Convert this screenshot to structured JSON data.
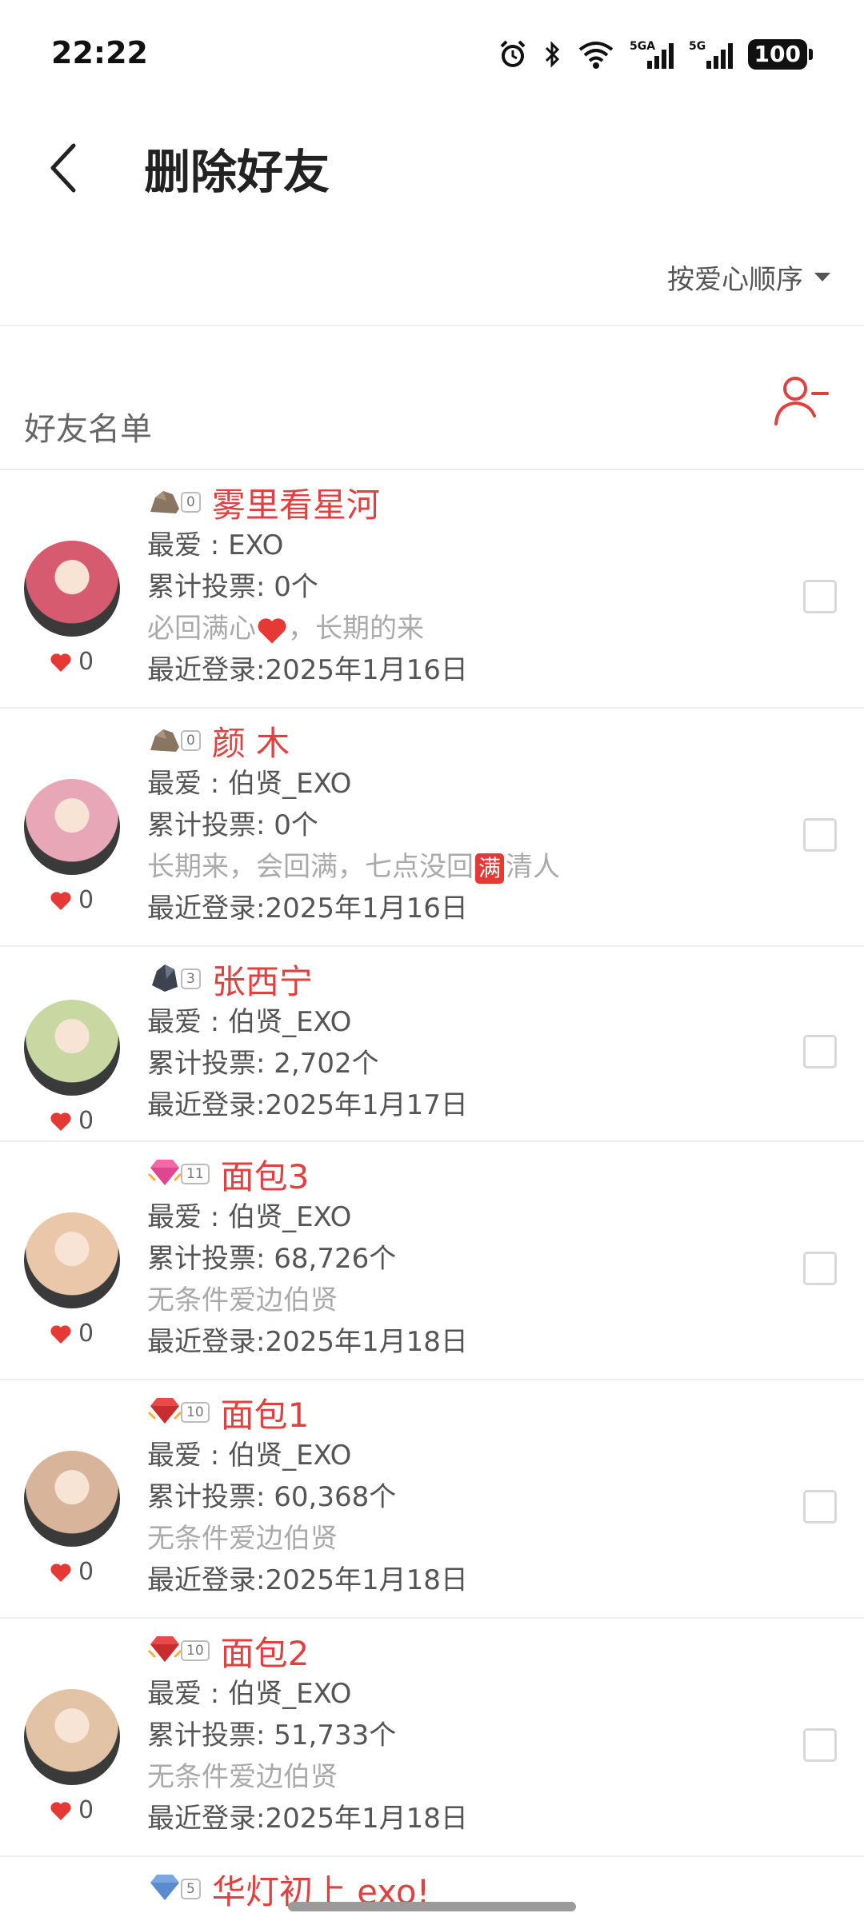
{
  "status": {
    "time": "22:22",
    "battery": "100",
    "net1": "5GA",
    "net2": "5G"
  },
  "header": {
    "title": "删除好友"
  },
  "sort": {
    "label": "按爱心顺序"
  },
  "friends": {
    "title": "好友名单"
  },
  "colors": {
    "accent": "#e04040",
    "muted": "#aaaaaa"
  },
  "rows": [
    {
      "gem": "rock",
      "level": "0",
      "name": "雾里看星河",
      "fav": "最爱 : EXO",
      "votes": "累计投票: 0个",
      "note_pre": "必回满心",
      "note_post": "，长期的来",
      "login": "最近登录:2025年1月16日",
      "hearts": "0",
      "avatar": "#d65b6f"
    },
    {
      "gem": "rock",
      "level": "0",
      "name": "颜 木",
      "fav": "最爱 : 伯贤_EXO",
      "votes": "累计投票: 0个",
      "note_pre": "长期来，会回满，七点没回",
      "note_badge": "满",
      "note_post": "清人",
      "login": "最近登录:2025年1月16日",
      "hearts": "0",
      "avatar": "#e8a7b7"
    },
    {
      "gem": "dark",
      "level": "3",
      "name": "张西宁",
      "fav": "最爱 : 伯贤_EXO",
      "votes": "累计投票: 2,702个",
      "login": "最近登录:2025年1月17日",
      "hearts": "0",
      "avatar": "#c9d8a3"
    },
    {
      "gem": "pink",
      "level": "11",
      "name": "面包3",
      "fav": "最爱 : 伯贤_EXO",
      "votes": "累计投票: 68,726个",
      "note": "无条件爱边伯贤",
      "login": "最近登录:2025年1月18日",
      "hearts": "0",
      "avatar": "#e9c7a8"
    },
    {
      "gem": "red",
      "level": "10",
      "name": "面包1",
      "fav": "最爱 : 伯贤_EXO",
      "votes": "累计投票: 60,368个",
      "note": "无条件爱边伯贤",
      "login": "最近登录:2025年1月18日",
      "hearts": "0",
      "avatar": "#d8b59a"
    },
    {
      "gem": "red",
      "level": "10",
      "name": "面包2",
      "fav": "最爱 : 伯贤_EXO",
      "votes": "累计投票: 51,733个",
      "note": "无条件爱边伯贤",
      "login": "最近登录:2025年1月18日",
      "hearts": "0",
      "avatar": "#e3c3a5"
    },
    {
      "gem": "blue",
      "level": "5",
      "name": "华灯初上 exo!"
    }
  ]
}
